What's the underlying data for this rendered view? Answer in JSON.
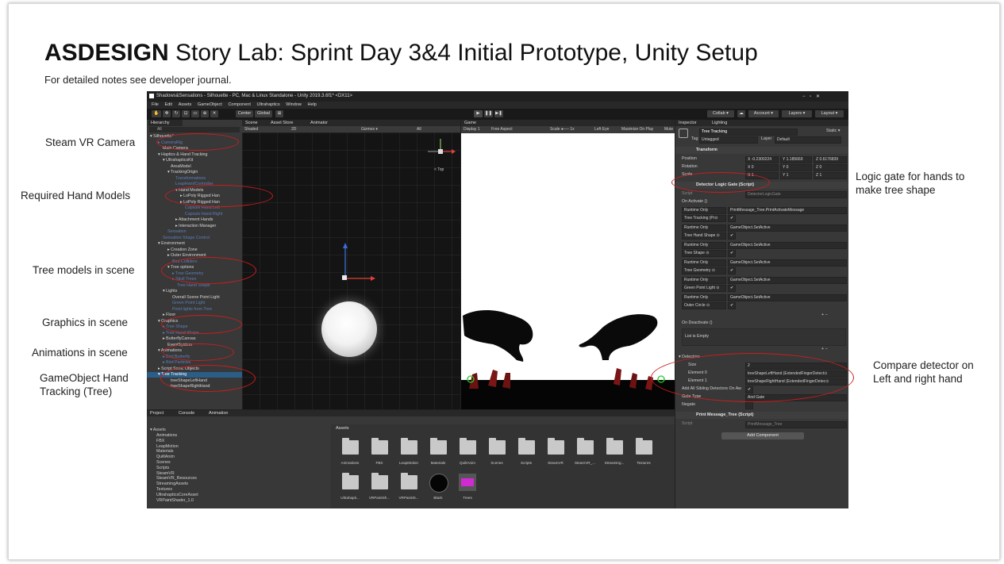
{
  "slide": {
    "title_bold": "ASDESIGN",
    "title_rest": " Story Lab: Sprint Day 3&4 Initial Prototype, Unity Setup",
    "subtitle": "For detailed notes see developer journal."
  },
  "annotations": {
    "steamvr_camera": "Steam VR Camera",
    "hand_models": "Required Hand Models",
    "tree_models": "Tree models in scene",
    "graphics": "Graphics in scene",
    "animations": "Animations in scene",
    "gameobject_line1": "GameObject Hand",
    "gameobject_line2": "Tracking (Tree)",
    "logic_gate_line1": "Logic gate for hands to",
    "logic_gate_line2": "make tree shape",
    "compare_line1": "Compare detector on",
    "compare_line2": "Left and right hand"
  },
  "unity": {
    "window_title": "Shadows&Sensations - Silhouette - PC, Mac & Linux Standalone - Unity 2019.3.6f1* <DX11>",
    "window_controls": "−   ▫   ✕",
    "menu": [
      "File",
      "Edit",
      "Assets",
      "GameObject",
      "Component",
      "Ultrahaptics",
      "Window",
      "Help"
    ],
    "toolbar": {
      "center": "Center",
      "global": "Global",
      "collab": "Collab ▾",
      "account": "Account ▾",
      "layers": "Layers ▾",
      "layout": "Layout ▾"
    },
    "hierarchy": {
      "tab": "Hierarchy",
      "search": "All",
      "rows": [
        {
          "text": "▾ Silhouette*",
          "indent": 4,
          "dim": false,
          "sel": false
        },
        {
          "text": "▸ CameraRig",
          "indent": 14,
          "dim": true,
          "sel": false
        },
        {
          "text": "Main Camera",
          "indent": 20,
          "dim": false,
          "sel": false
        },
        {
          "text": "▾ Haptics & Hand Tracking",
          "indent": 14,
          "dim": false,
          "sel": false
        },
        {
          "text": "▾ UltrahapticsKit",
          "indent": 20,
          "dim": false,
          "sel": false
        },
        {
          "text": "AreaModel",
          "indent": 30,
          "dim": false,
          "sel": false
        },
        {
          "text": "▾ TrackingOrigin",
          "indent": 26,
          "dim": false,
          "sel": false
        },
        {
          "text": "Transformations",
          "indent": 36,
          "dim": true,
          "sel": false
        },
        {
          "text": "LeapHandController",
          "indent": 36,
          "dim": true,
          "sel": false
        },
        {
          "text": "▾ Hand Models",
          "indent": 36,
          "dim": false,
          "sel": false
        },
        {
          "text": "▸ LoPoly Rigged Han",
          "indent": 42,
          "dim": false,
          "sel": false
        },
        {
          "text": "▸ LoPoly Rigged Han",
          "indent": 42,
          "dim": false,
          "sel": false
        },
        {
          "text": "Capsule Hand Left",
          "indent": 48,
          "dim": true,
          "sel": false
        },
        {
          "text": "Capsule Hand Right",
          "indent": 48,
          "dim": true,
          "sel": false
        },
        {
          "text": "▸ Attachment Hands",
          "indent": 36,
          "dim": false,
          "sel": false
        },
        {
          "text": "▸ Interaction Manager",
          "indent": 36,
          "dim": false,
          "sel": false
        },
        {
          "text": "Sensation",
          "indent": 26,
          "dim": true,
          "sel": false
        },
        {
          "text": "Sensation Shape Control",
          "indent": 20,
          "dim": true,
          "sel": false
        },
        {
          "text": "▾ Environment",
          "indent": 14,
          "dim": false,
          "sel": false
        },
        {
          "text": "▸ Creation Zone",
          "indent": 26,
          "dim": false,
          "sel": false
        },
        {
          "text": "▸ Outer Environment",
          "indent": 26,
          "dim": false,
          "sel": false
        },
        {
          "text": "Bird Colliders",
          "indent": 32,
          "dim": true,
          "sel": false
        },
        {
          "text": "▾ Tree options",
          "indent": 26,
          "dim": false,
          "sel": false
        },
        {
          "text": "▸ Tree Geometry",
          "indent": 32,
          "dim": true,
          "sel": false
        },
        {
          "text": "▸ Skull Trees",
          "indent": 32,
          "dim": true,
          "sel": false
        },
        {
          "text": "Tree Hand Shape",
          "indent": 38,
          "dim": true,
          "sel": false
        },
        {
          "text": "▾ Lights",
          "indent": 20,
          "dim": false,
          "sel": false
        },
        {
          "text": "Overall Scene Point Light",
          "indent": 32,
          "dim": false,
          "sel": false
        },
        {
          "text": "Green Point Light",
          "indent": 32,
          "dim": true,
          "sel": false
        },
        {
          "text": "Point lights from Tree",
          "indent": 32,
          "dim": true,
          "sel": false
        },
        {
          "text": "▸ Floor",
          "indent": 20,
          "dim": false,
          "sel": false
        },
        {
          "text": "▾ Graphics",
          "indent": 14,
          "dim": false,
          "sel": false
        },
        {
          "text": "▸ Tree Shape",
          "indent": 20,
          "dim": true,
          "sel": false
        },
        {
          "text": "▸ Tree Hand Shape",
          "indent": 20,
          "dim": true,
          "sel": false
        },
        {
          "text": "▸ ButterflyCanvas",
          "indent": 20,
          "dim": false,
          "sel": false
        },
        {
          "text": "EventSystem",
          "indent": 26,
          "dim": false,
          "sel": false
        },
        {
          "text": "▾ Animations",
          "indent": 14,
          "dim": false,
          "sel": false
        },
        {
          "text": "▸ Bird Butterfly",
          "indent": 20,
          "dim": true,
          "sel": false
        },
        {
          "text": "▸ Bird Particles",
          "indent": 20,
          "dim": true,
          "sel": false
        },
        {
          "text": "▸ Script Sonic Objects",
          "indent": 14,
          "dim": false,
          "sel": false
        },
        {
          "text": "▾ Tree Tracking",
          "indent": 14,
          "dim": false,
          "sel": true
        },
        {
          "text": "treeShapeLeftHand",
          "indent": 30,
          "dim": false,
          "sel": false
        },
        {
          "text": "treeShapeRightHand",
          "indent": 30,
          "dim": false,
          "sel": false
        }
      ]
    },
    "scene": {
      "tabs": [
        "Scene",
        "Asset Store",
        "Animator"
      ],
      "shading": "Shaded",
      "mode": "2D",
      "gizmos": "Gizmos ▾",
      "search": "All",
      "axis_label": "< Top"
    },
    "game": {
      "tab": "Game",
      "display": "Display 1",
      "aspect": "Free Aspect",
      "scale": "Scale ●── 1x",
      "left_eye": "Left Eye",
      "maximize": "Maximize On Play",
      "mute": "Mute"
    },
    "inspector": {
      "tabs": [
        "Inspector",
        "Lighting"
      ],
      "object_name": "Tree Tracking",
      "static": "Static ▾",
      "tag_label": "Tag",
      "tag_value": "Untagged",
      "layer_label": "Layer",
      "layer_value": "Default",
      "transform": "Transform",
      "position_label": "Position",
      "rotation_label": "Rotation",
      "scale_label": "Scale",
      "pos_x": "X -0.2300224",
      "pos_y": "Y 1.185669",
      "pos_z": "Z 0.6176839",
      "rot_x": "X 0",
      "rot_y": "Y 0",
      "rot_z": "Z 0",
      "scale_x": "X 1",
      "scale_y": "Y 1",
      "scale_z": "Z 1",
      "component1": "Detector Logic Gate (Script)",
      "script_label": "Script",
      "script_value": "DetectorLogicGate",
      "on_activate": "On Activate ()",
      "events": [
        {
          "runtime": "Runtime Only",
          "method": "PrintMessage_Tree.PrintActivateMessage",
          "obj": "Tree Tracking (Pr⊙"
        },
        {
          "runtime": "Runtime Only",
          "method": "GameObject.SetActive",
          "obj": "Tree Hand Shape ⊙"
        },
        {
          "runtime": "Runtime Only",
          "method": "GameObject.SetActive",
          "obj": "Tree Shape ⊙"
        },
        {
          "runtime": "Runtime Only",
          "method": "GameObject.SetActive",
          "obj": "Tree Geometry ⊙"
        },
        {
          "runtime": "Runtime Only",
          "method": "GameObject.SetActive",
          "obj": "Green Point Light ⊙"
        },
        {
          "runtime": "Runtime Only",
          "method": "GameObject.SetActive",
          "obj": "Outer Circle ⊙"
        }
      ],
      "plus_minus": "+ −",
      "on_deactivate": "On Deactivate ()",
      "list_empty": "List is Empty",
      "detectors": "▾ Detectors",
      "size_label": "Size",
      "size_value": "2",
      "element0_label": "Element 0",
      "element0_value": "treeShapeLeftHand (ExtendedFingerDetect⊙",
      "element1_label": "Element 1",
      "element1_value": "treeShapeRightHand (ExtendedFingerDetec⊙",
      "add_sibling": "Add All Sibling Detectors On Aw",
      "gate_type_label": "Gate Type",
      "gate_type_value": "And Gate",
      "negate_label": "Negate",
      "component2": "Print Message_Tree (Script)",
      "script2_value": "PrintMessage_Tree",
      "add_component": "Add Component"
    },
    "project": {
      "tabs": [
        "Project",
        "Console",
        "Animation"
      ],
      "tree_root": "▾ Assets",
      "tree": [
        "Animations",
        "FBX",
        "LeapMotion",
        "Materials",
        "QuiltAnim",
        "Scenes",
        "Scripts",
        "SteamVR",
        "SteamVR_Resources",
        "StreamingAssets",
        "Textures",
        "UltrahapticsCoreAsset",
        "VRPaintShader_1.0"
      ],
      "breadcrumb": "Assets",
      "assets_row1": [
        "Animations",
        "FBX",
        "LeapMotion",
        "Materials",
        "QuiltAnim",
        "Scenes",
        "Scripts",
        "SteamVR",
        "SteamVR_...",
        "Streaming...",
        "Textures"
      ],
      "assets_row2": [
        "Ultrahapti...",
        "VRPaintSh...",
        "VRPaintSt...",
        "Black",
        "Trees"
      ]
    }
  },
  "colors": {
    "ellipse": "#cc1d1d",
    "unity_bg": "#383838",
    "selection": "#2c5d87"
  }
}
